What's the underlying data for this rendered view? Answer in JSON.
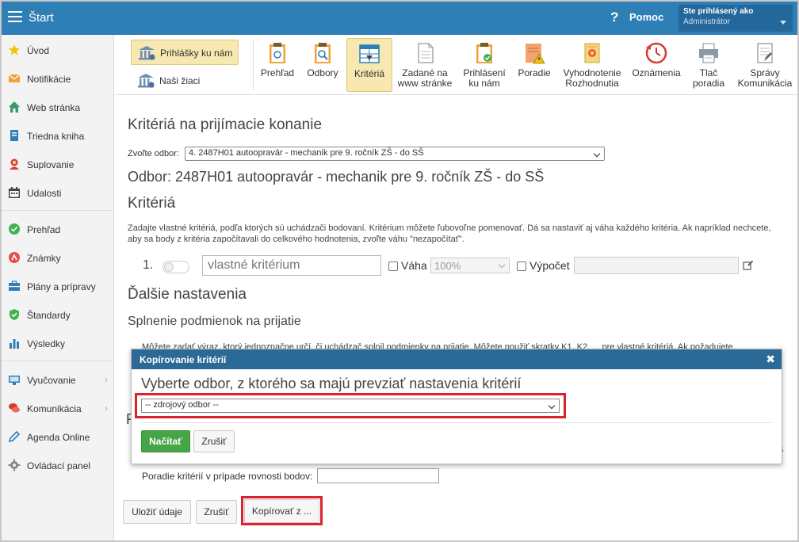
{
  "topbar": {
    "title": "Štart",
    "help_label": "Pomoc",
    "user_line1": "Ste prihlásený ako",
    "user_line2": "Administrátor"
  },
  "sidebar": {
    "items": [
      {
        "label": "Úvod",
        "icon": "star-icon"
      },
      {
        "label": "Notifikácie",
        "icon": "envelope-icon"
      },
      {
        "label": "Web stránka",
        "icon": "home-icon"
      },
      {
        "label": "Triedna kniha",
        "icon": "book-icon"
      },
      {
        "label": "Suplovanie",
        "icon": "user-icon"
      },
      {
        "label": "Udalosti",
        "icon": "calendar-icon"
      },
      {
        "label": "Prehľad",
        "icon": "check-circle-icon"
      },
      {
        "label": "Známky",
        "icon": "grade-icon"
      },
      {
        "label": "Plány a prípravy",
        "icon": "briefcase-icon"
      },
      {
        "label": "Štandardy",
        "icon": "shield-icon"
      },
      {
        "label": "Výsledky",
        "icon": "bar-chart-icon"
      },
      {
        "label": "Vyučovanie",
        "icon": "teaching-icon"
      },
      {
        "label": "Komunikácia",
        "icon": "chat-icon"
      },
      {
        "label": "Agenda Online",
        "icon": "pen-icon"
      },
      {
        "label": "Ovládací panel",
        "icon": "gear-icon"
      }
    ]
  },
  "toolbar": {
    "left_buttons": [
      {
        "label": "Prihlášky ku nám"
      },
      {
        "label": "Naši žiaci"
      }
    ],
    "buttons": [
      {
        "label1": "Prehľad",
        "label2": ""
      },
      {
        "label1": "Odbory",
        "label2": ""
      },
      {
        "label1": "Kritériá",
        "label2": ""
      },
      {
        "label1": "Zadané na",
        "label2": "www stránke"
      },
      {
        "label1": "Prihlásení",
        "label2": "ku nám"
      },
      {
        "label1": "Poradie",
        "label2": ""
      },
      {
        "label1": "Vyhodnotenie",
        "label2": "Rozhodnutia"
      },
      {
        "label1": "Oznámenia",
        "label2": ""
      },
      {
        "label1": "Tlač",
        "label2": "poradia"
      },
      {
        "label1": "Správy",
        "label2": "Komunikácia"
      }
    ]
  },
  "main": {
    "heading": "Kritériá na prijímacie konanie",
    "odbor_label": "Zvoľte odbor:",
    "odbor_selected": "4. 2487H01 autoopravár - mechanik pre 9. ročník ZŠ - do SŠ",
    "odbor_title": "Odbor: 2487H01 autoopravár - mechanik pre 9. ročník ZŠ - do SŠ",
    "criteria_heading": "Kritériá",
    "criteria_desc": "Zadajte vlastné kritériá, podľa ktorých sú uchádzači bodovaní. Kritérium môžete ľubovoľne pomenovať. Dá sa nastaviť aj váha každého kritéria. Ak napríklad nechcete, aby sa body z kritéria započítavali do celkového hodnotenia, zvoľte váhu \"nezapočítať\".",
    "criterion_num": "1.",
    "criterion_placeholder": "vlastné kritérium",
    "vaha_label": "Váha",
    "vaha_value": "100%",
    "vypocet_label": "Výpočet",
    "further_heading": "Ďalšie nastavenia",
    "conditions_heading": "Splnenie podmienok na prijatie",
    "conditions_desc": "Môžete zadať výraz, ktorý jednoznačne určí, či uchádzač splnil podmienky na prijatie. Môžete použiť skratky K1, K2, ... pre vlastné kritériá. Ak požadujete,",
    "hidden_heading_letter": "F",
    "hidden_right_letter": "S",
    "order_label": "Poradie kritérií v prípade rovnosti bodov:",
    "save_label": "Uložiť údaje",
    "cancel_label": "Zrušiť",
    "copy_label": "Kopírovať z ..."
  },
  "modal": {
    "header": "Kopírovanie kritérií",
    "title": "Vyberte odbor, z ktorého sa majú prevziať nastavenia kritérií",
    "select_value": "-- zdrojový odbor --",
    "load_label": "Načítať",
    "cancel_label": "Zrušiť"
  },
  "colors": {
    "topbar": "#2f7fb7",
    "modal_header": "#2b6a96",
    "highlight": "#d9232e",
    "primary_button": "#46a546",
    "active_tab": "#f6e8b0"
  }
}
